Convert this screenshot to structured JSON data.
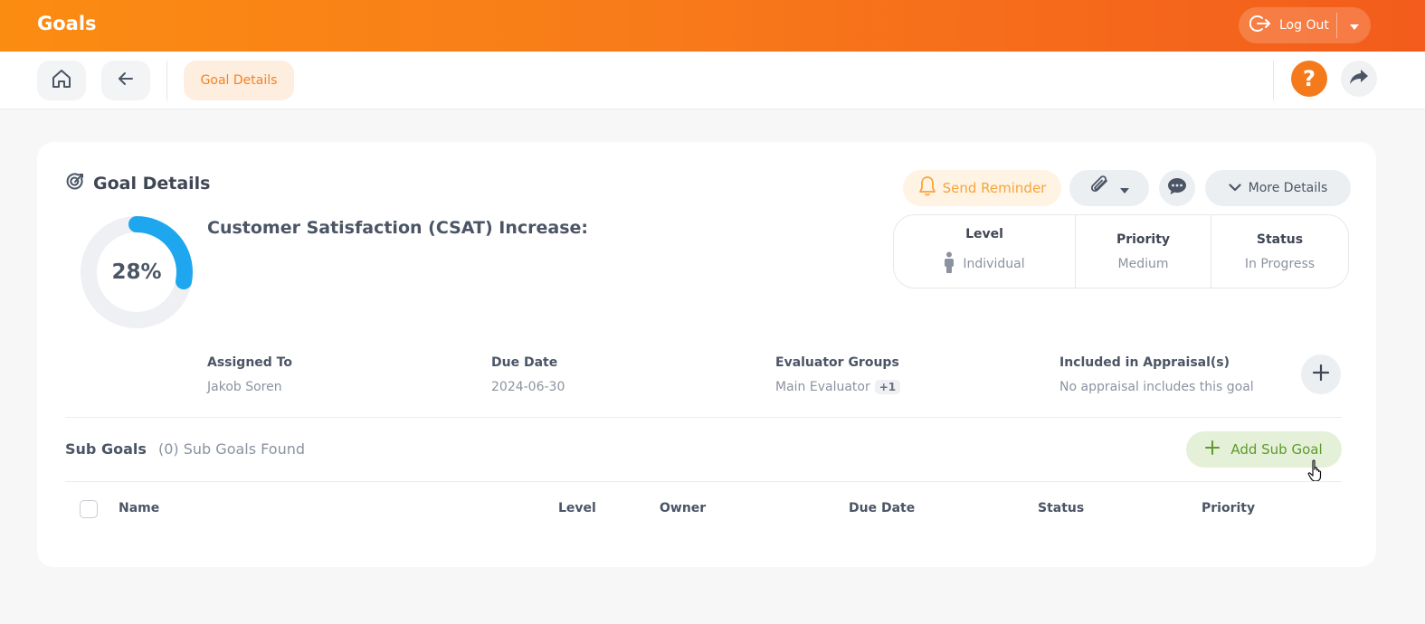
{
  "header": {
    "app_title": "Goals",
    "logout_label": "Log Out",
    "logout_icon": "logout-icon",
    "menu_icon": "caret-down-icon"
  },
  "subheader": {
    "home_icon": "home-icon",
    "back_icon": "arrow-left-icon",
    "breadcrumb": "Goal Details",
    "help_label": "?",
    "share_icon": "share-arrow-icon"
  },
  "card": {
    "title": "Goal Details",
    "title_icon": "target-icon",
    "progress": 0.28,
    "progress_label": "28%",
    "goal_name": "Customer Satisfaction (CSAT) Increase:",
    "actions": {
      "send_reminder": "Send Reminder",
      "more_details": "More Details"
    },
    "meta": {
      "level_label": "Level",
      "level_value": "Individual",
      "priority_label": "Priority",
      "priority_value": "Medium",
      "status_label": "Status",
      "status_value": "In Progress"
    },
    "info": {
      "assigned_label": "Assigned To",
      "assigned_value": "Jakob Soren",
      "due_label": "Due Date",
      "due_value": "2024-06-30",
      "evaluator_label": "Evaluator Groups",
      "evaluator_value": "Main Evaluator",
      "evaluator_extra": "+1",
      "appraisal_label": "Included in Appraisal(s)",
      "appraisal_value": "No appraisal includes this goal"
    },
    "sub_goals": {
      "title": "Sub Goals",
      "count_text": "(0) Sub Goals Found",
      "add_label": "Add Sub Goal",
      "columns": [
        "Name",
        "Level",
        "Owner",
        "Due Date",
        "Status",
        "Priority"
      ]
    }
  },
  "colors": {
    "accent": "#f57a1b",
    "progress": "#1ea7ee",
    "progress_track": "#eef0f4",
    "success_bg": "#e5f0d9"
  }
}
